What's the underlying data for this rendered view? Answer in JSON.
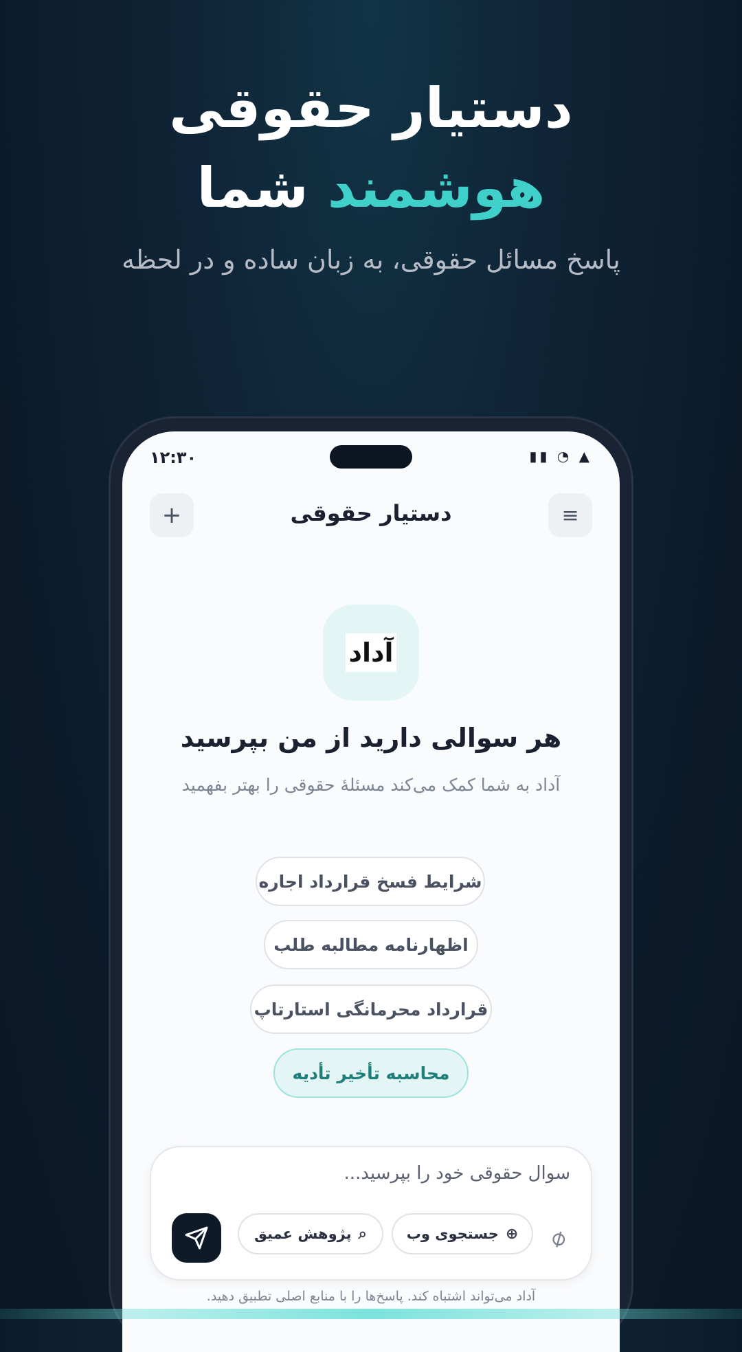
{
  "hero": {
    "title_line1": "دستیار حقوقی",
    "title_accent": "هوشمند",
    "title_rest": "شما",
    "subtitle": "پاسخ مسائل حقوقی، به زبان ساده و در لحظه",
    "accent_color": "#3fd0c9"
  },
  "status_bar": {
    "time": "۱۲:۳۰",
    "icons": [
      "signal-bars-icon",
      "clock-icon",
      "wifi-triangle-icon"
    ]
  },
  "app_header": {
    "title": "دستیار حقوقی",
    "menu_icon": "hamburger-menu-icon",
    "new_chat_icon": "plus-icon"
  },
  "welcome": {
    "logo_text": "آداد",
    "heading": "هر سوالی دارید از من بپرسید",
    "subtext": "آداد به شما کمک می‌کند مسئلهٔ حقوقی را بهتر بفهمید"
  },
  "suggestions": [
    {
      "label": "شرایط فسخ قرارداد اجاره"
    },
    {
      "label": "اظهارنامه مطالبه طلب"
    },
    {
      "label": "قرارداد محرمانگی استارتاپ"
    },
    {
      "label": "محاسبه تأخیر تأدیه"
    }
  ],
  "composer": {
    "placeholder": "سوال حقوقی خود را بپرسید...",
    "web_search_label": "جستجوی وب",
    "deep_research_label": "پژوهش عمیق",
    "attach_icon": "paperclip-icon",
    "send_icon": "send-paper-plane-icon"
  },
  "disclaimer": "آداد می‌تواند اشتباه کند. پاسخ‌ها را با منابع اصلی تطبیق دهید."
}
